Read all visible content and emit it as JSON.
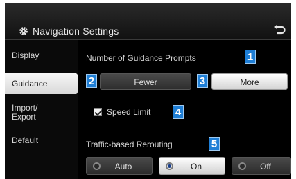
{
  "header": {
    "title": "Navigation Settings",
    "gear_icon": "gear-icon",
    "back_icon": "back-arrow-icon"
  },
  "sidebar": {
    "items": [
      {
        "label": "Display",
        "active": false
      },
      {
        "label": "Guidance",
        "active": true
      },
      {
        "label": "Import/\nExport",
        "active": false
      },
      {
        "label": "Default",
        "active": false
      }
    ]
  },
  "guidance": {
    "prompts_label": "Number of Guidance Prompts",
    "fewer_label": "Fewer",
    "more_label": "More",
    "selected_prompts": "More",
    "speed_limit_label": "Speed Limit",
    "speed_limit_checked": true,
    "rerouting_label": "Traffic-based Rerouting",
    "rerouting_options": [
      "Auto",
      "On",
      "Off"
    ],
    "rerouting_selected": "On"
  },
  "callouts": [
    "1",
    "2",
    "3",
    "4",
    "5"
  ],
  "colors": {
    "callout_blue": "#1f7fd6",
    "background": "#000000",
    "active_bg": "#e8e8e8"
  }
}
